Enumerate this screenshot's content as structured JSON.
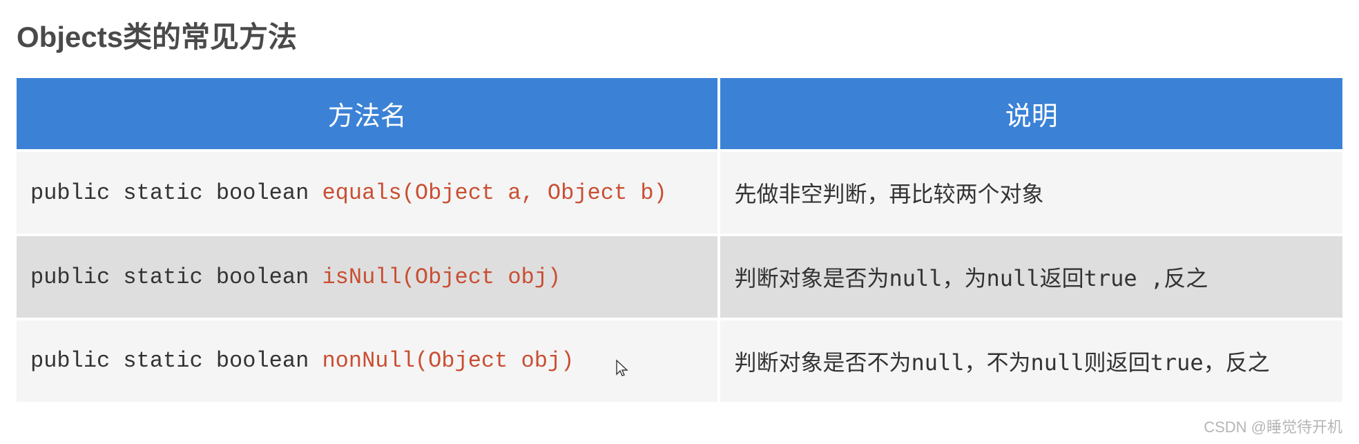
{
  "title": "Objects类的常见方法",
  "headers": {
    "method": "方法名",
    "description": "说明"
  },
  "rows": [
    {
      "prefix": "public static boolean ",
      "highlight": "equals(Object a, Object b)",
      "description": "先做非空判断，再比较两个对象"
    },
    {
      "prefix": "public static boolean ",
      "highlight": "isNull(Object obj)",
      "description": "判断对象是否为null，为null返回true ,反之"
    },
    {
      "prefix": "public static boolean ",
      "highlight": "nonNull(Object obj)",
      "description": "判断对象是否不为null，不为null则返回true，反之"
    }
  ],
  "watermark": "CSDN @睡觉待开机"
}
